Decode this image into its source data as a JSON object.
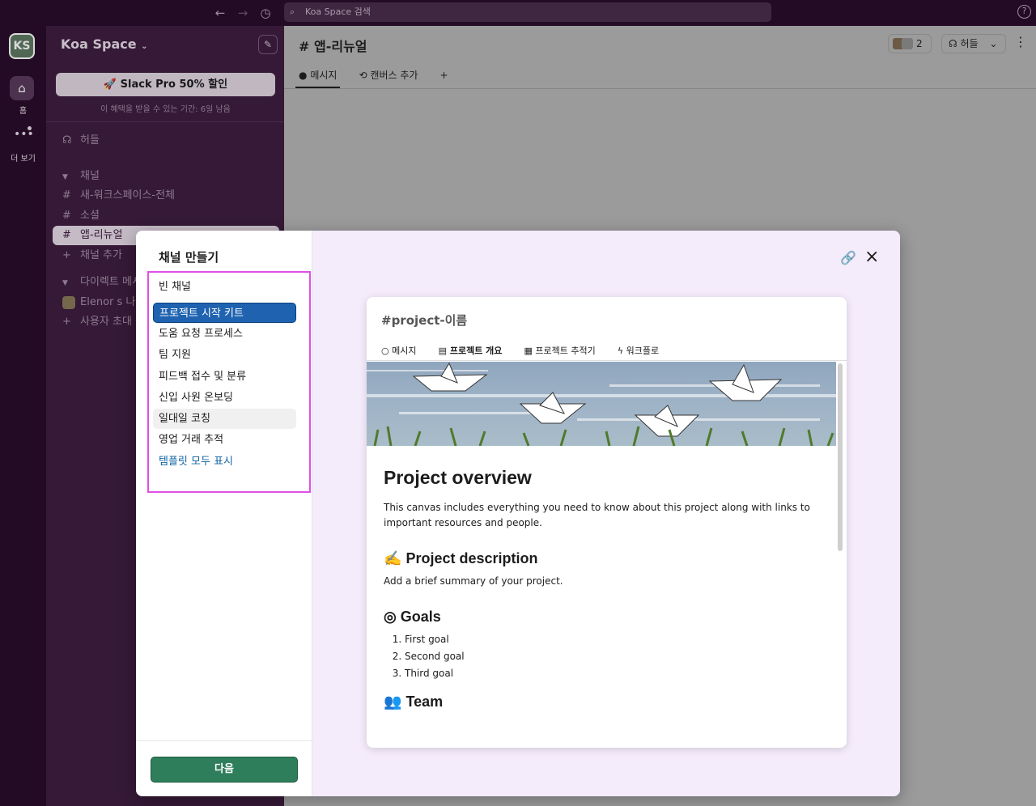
{
  "topbar": {
    "search_placeholder": "Koa Space 검색",
    "help": "?"
  },
  "rail": {
    "workspace_initials": "KS",
    "home_label": "홈",
    "more_label": "더 보기"
  },
  "sidebar": {
    "workspace_name": "Koa Space",
    "promo_button": "Slack Pro 50% 할인",
    "promo_sub": "이 혜택을 받을 수 있는 기간: 6일 남음",
    "huddles": "허들",
    "channels_header": "채널",
    "channels": [
      "새-워크스페이스-전체",
      "소셜",
      "앱-리뉴얼"
    ],
    "add_channel": "채널 추가",
    "dm_header": "다이렉트 메시",
    "dm_user": "Elenor s  나",
    "invite_users": "사용자 초대"
  },
  "main": {
    "channel_title": "앱-리뉴얼",
    "tabs": [
      "메시지",
      "캔버스 추가"
    ],
    "member_count": "2",
    "huddle_label": "허들"
  },
  "modal": {
    "title": "채널 만들기",
    "templates": [
      "빈 채널",
      "프로젝트 시작 키트",
      "도움 요청 프로세스",
      "팀 지원",
      "피드백 접수 및 분류",
      "신입 사원 온보딩",
      "일대일 코칭",
      "영업 거래 추적"
    ],
    "show_all": "템플릿 모두 표시",
    "next_button": "다음",
    "preview": {
      "channel_name": "#project-이름",
      "tabs": [
        "메시지",
        "프로젝트 개요",
        "프로젝트 추적기",
        "워크플로"
      ],
      "doc_title": "Project overview",
      "intro": "This canvas includes everything you need to know about this project along with links to important resources and people.",
      "desc_heading": "Project description",
      "desc_text": "Add a brief summary of your project.",
      "goals_heading": "Goals",
      "goals": [
        "First goal",
        "Second goal",
        "Third goal"
      ],
      "team_heading": "Team"
    }
  },
  "colors": {
    "selected_template": "#1f63b0",
    "next_button": "#2e7d5b",
    "highlight_box": "#e050e6",
    "sidebar_bg": "#3f1e40"
  }
}
